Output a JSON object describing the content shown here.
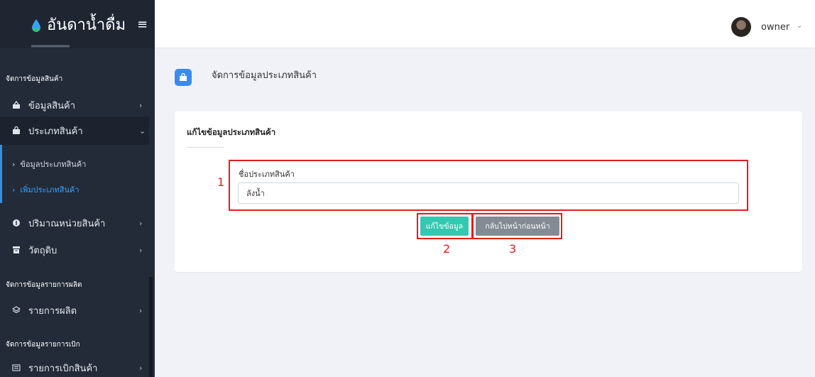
{
  "app": {
    "brand": "อันดาน้ำดื่ม",
    "menu_icon": "hamburger-icon"
  },
  "user": {
    "name": "owner"
  },
  "sidebar": {
    "sections": [
      {
        "title": "จัดการข้อมูลสินค้า"
      },
      {
        "title": "จัดการข้อมูลรายการผลิต"
      },
      {
        "title": "จัดการข้อมูลรายการเบิก"
      }
    ],
    "items": [
      {
        "label": "ข้อมูลสินค้า",
        "icon": "basket-icon"
      },
      {
        "label": "ประเภทสินค้า",
        "icon": "bag-icon"
      },
      {
        "label": "ปริมาณหน่วยสินค้า",
        "icon": "circle-icon"
      },
      {
        "label": "วัตถุดิบ",
        "icon": "box-icon"
      },
      {
        "label": "รายการผลิต",
        "icon": "layers-icon"
      },
      {
        "label": "รายการเบิกสินค้า",
        "icon": "list-icon"
      }
    ],
    "subitems": [
      {
        "label": "ข้อมูลประเภทสินค้า"
      },
      {
        "label": "เพิ่มประเภทสินค้า"
      }
    ]
  },
  "page": {
    "title": "จัดการข้อมูลประเภทสินค้า",
    "icon": "shopping-bag-icon"
  },
  "card": {
    "title": "แก้ไขข้อมูลประเภทสินค้า",
    "field_label": "ชื่อประเภทสินค้า",
    "field_value": "ลังน้ำ",
    "save_label": "แก้ไขข้อมูล",
    "back_label": "กลับไปหน้าก่อนหน้า"
  },
  "annotations": {
    "n1": "1",
    "n2": "2",
    "n3": "3"
  },
  "colors": {
    "sidebar": "#232b38",
    "accent": "#3b8bec",
    "save": "#35c8b0",
    "back": "#848b94",
    "annotation": "#e11d1d"
  }
}
